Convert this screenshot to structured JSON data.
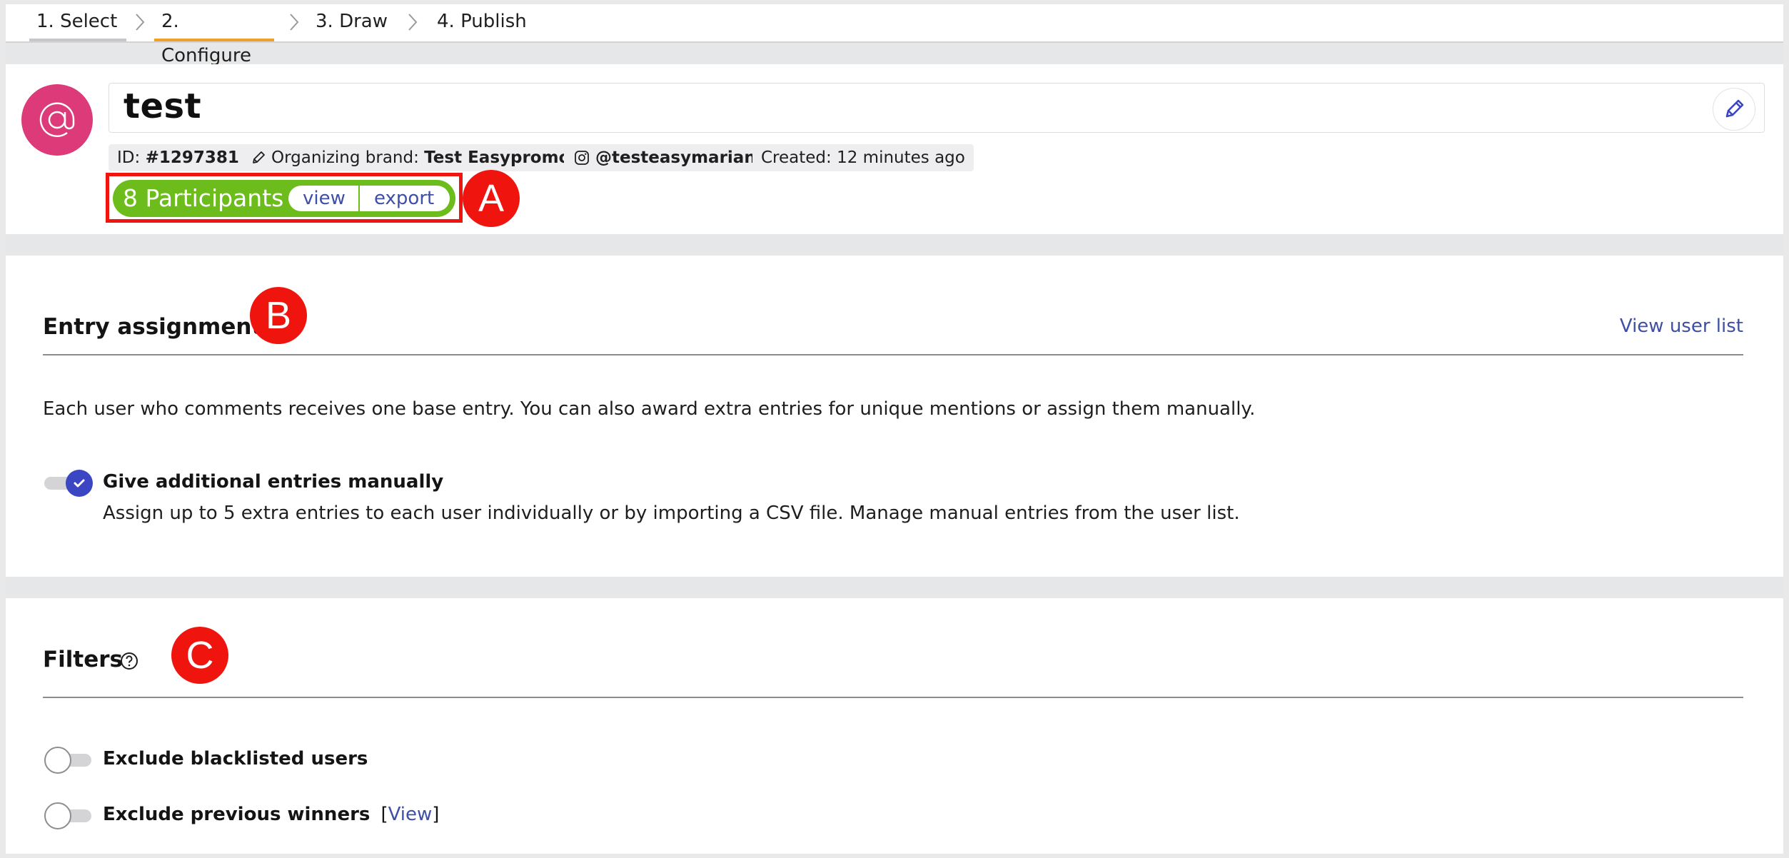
{
  "steps": [
    {
      "label": "1. Select",
      "state": "done"
    },
    {
      "label": "2. Configure",
      "state": "active"
    },
    {
      "label": "3. Draw",
      "state": "todo"
    },
    {
      "label": "4. Publish",
      "state": "todo"
    }
  ],
  "header": {
    "avatar_icon": "at-sign-icon",
    "title": "test",
    "edit_icon": "pencil-icon",
    "id_label": "ID:",
    "id_value": "#1297381",
    "brand_label": "Organizing brand:",
    "brand_value": "Test Easypromos",
    "instagram_handle": "@testeasymarian",
    "created": "Created: 12 minutes ago"
  },
  "participants": {
    "count_label": "8 Participants",
    "view_label": "view",
    "export_label": "export"
  },
  "annotations": {
    "a": "A",
    "b": "B",
    "c": "C"
  },
  "entry_assignment": {
    "title": "Entry assignment",
    "view_user_list": "View user list",
    "description": "Each user who comments receives one base entry. You can also award extra entries for unique mentions or assign them manually.",
    "manual_toggle": {
      "label": "Give additional entries manually",
      "on": true,
      "help": "Assign up to 5 extra entries to each user individually or by importing a CSV file. Manage manual entries from the user list."
    }
  },
  "filters": {
    "title": "Filters",
    "items": [
      {
        "label": "Exclude blacklisted users",
        "on": false
      },
      {
        "label": "Exclude previous winners",
        "on": false,
        "bracket_open": "[",
        "link": "View",
        "bracket_close": "]"
      }
    ]
  },
  "colors": {
    "accent": "#3a46c2",
    "active_step": "#f0a02a",
    "participants_green": "#6cbd1b",
    "avatar_pink": "#dc3a78",
    "annotation_red": "#f0140f",
    "link": "#3f4fa6"
  }
}
